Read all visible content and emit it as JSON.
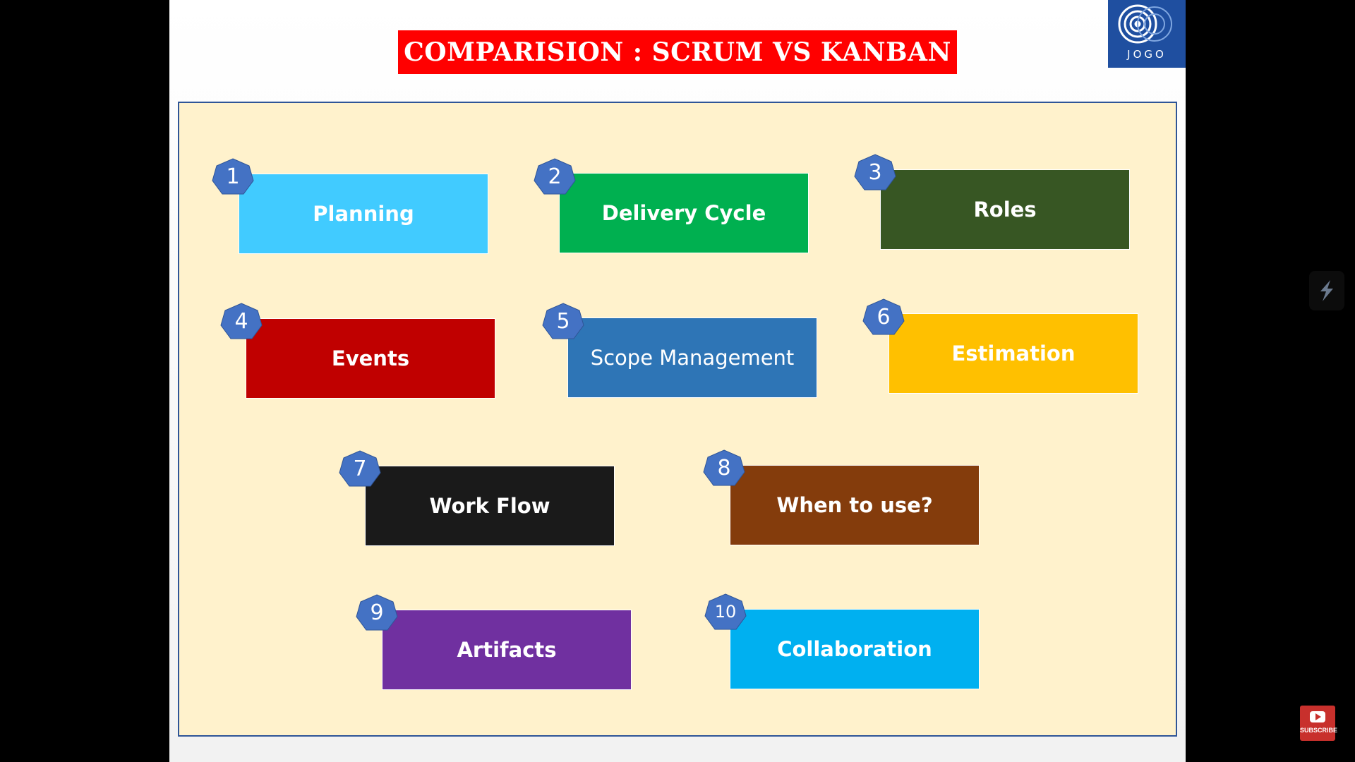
{
  "slide": {
    "title": "COMPARISION : SCRUM VS KANBAN",
    "logo_text": "JOGO"
  },
  "topics": [
    {
      "number": "1",
      "label": "Planning",
      "color": "#41cbff"
    },
    {
      "number": "2",
      "label": "Delivery Cycle",
      "color": "#00b050"
    },
    {
      "number": "3",
      "label": "Roles",
      "color": "#375623"
    },
    {
      "number": "4",
      "label": "Events",
      "color": "#c00000"
    },
    {
      "number": "5",
      "label": "Scope Management",
      "color": "#2e75b6"
    },
    {
      "number": "6",
      "label": "Estimation",
      "color": "#ffc000"
    },
    {
      "number": "7",
      "label": "Work Flow",
      "color": "#1a1a1a"
    },
    {
      "number": "8",
      "label": "When to use?",
      "color": "#843c0c"
    },
    {
      "number": "9",
      "label": "Artifacts",
      "color": "#7030a0"
    },
    {
      "number": "10",
      "label": "Collaboration",
      "color": "#00b0f0"
    }
  ],
  "overlay": {
    "subscribe_label": "SUBSCRIBE",
    "side_icon": "lightning-logo-icon",
    "subscribe_icon": "youtube-play-icon"
  },
  "colors": {
    "title_bg": "#ff0000",
    "logo_bg": "#1f4fa0",
    "panel_bg": "#fff2cc",
    "panel_border": "#2f5597",
    "badge": "#4472c4"
  }
}
